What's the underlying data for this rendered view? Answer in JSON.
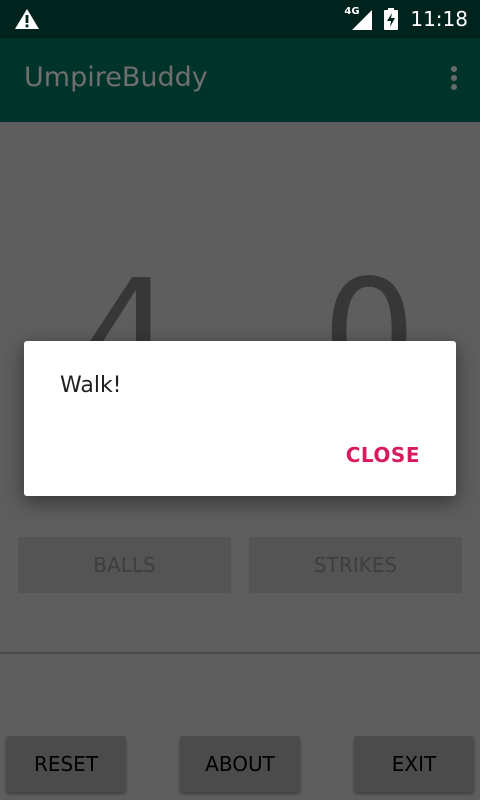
{
  "status_bar": {
    "warning_icon": "warning-icon",
    "network_label": "4G",
    "signal_icon": "signal-icon",
    "battery_icon": "battery-charging-icon",
    "time": "11:18"
  },
  "app_bar": {
    "title": "UmpireBuddy",
    "overflow_icon": "more-vert-icon"
  },
  "main": {
    "balls_count": "4",
    "strikes_count": "0",
    "balls_label": "BALLS",
    "strikes_label": "STRIKES"
  },
  "bottom_bar": {
    "reset_label": "RESET",
    "about_label": "ABOUT",
    "exit_label": "EXIT"
  },
  "dialog": {
    "message": "Walk!",
    "close_label": "CLOSE"
  },
  "colors": {
    "status_bar_bg": "#00241d",
    "app_bar_bg": "#003329",
    "dim_background": "#5e5e5e",
    "dialog_bg": "#ffffff",
    "accent": "#d81b60"
  }
}
